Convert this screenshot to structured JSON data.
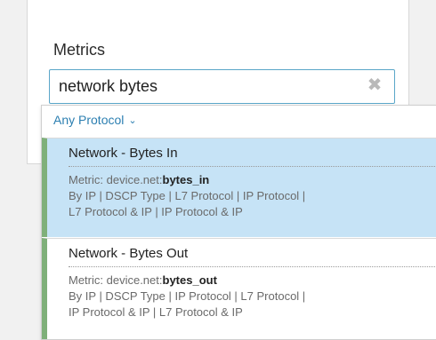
{
  "metrics": {
    "label": "Metrics",
    "search_value": "network bytes",
    "clear_glyph": "✖"
  },
  "dropdown": {
    "protocol_filter": "Any Protocol",
    "chevron_glyph": "⌄",
    "results": [
      {
        "title": "Network - Bytes In",
        "metric_prefix": "Metric: device.net:",
        "metric_name": "bytes_in",
        "groups_line1": "By IP | DSCP Type | L7 Protocol | IP Protocol |",
        "groups_line2": "L7 Protocol & IP | IP Protocol & IP"
      },
      {
        "title": "Network - Bytes Out",
        "metric_prefix": "Metric: device.net:",
        "metric_name": "bytes_out",
        "groups_line1": "By IP | DSCP Type | IP Protocol | L7 Protocol |",
        "groups_line2": "IP Protocol & IP | L7 Protocol & IP"
      }
    ]
  },
  "colors": {
    "accent": "#2c7fb1",
    "input_border": "#5aa6c8",
    "selected_bg": "#c6e3f6",
    "result_bar": "#7fb07a"
  }
}
